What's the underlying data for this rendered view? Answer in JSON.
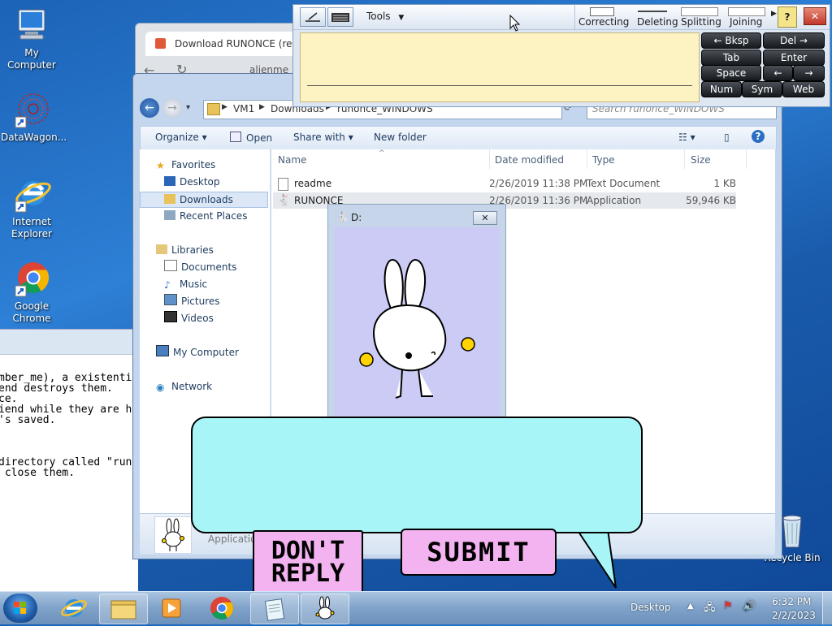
{
  "desktop": {
    "icons": [
      {
        "label": "My Computer"
      },
      {
        "label": "DataWagon..."
      },
      {
        "label": "Internet Explorer"
      },
      {
        "label": "Google Chrome"
      },
      {
        "label": "Recycle Bin"
      }
    ]
  },
  "notepad": {
    "lines": [
      "mber_me), a existenti",
      "end destroys them.",
      "ce.",
      "iend while they are h",
      "'s saved.",
      "",
      "",
      "directory called \"run",
      " close them."
    ]
  },
  "chrome_window": {
    "tab_title": "Download RUNONCE (reme",
    "address_partial": "alienme"
  },
  "explorer": {
    "breadcrumb": [
      "VM1",
      "Downloads",
      "runonce_WINDOWS"
    ],
    "search_placeholder": "Search runonce_WINDOWS",
    "toolbar": {
      "organize": "Organize",
      "open": "Open",
      "share_with": "Share with",
      "new_folder": "New folder"
    },
    "nav": {
      "favorites": "Favorites",
      "desktop": "Desktop",
      "downloads": "Downloads",
      "recent_places": "Recent Places",
      "libraries": "Libraries",
      "documents": "Documents",
      "music": "Music",
      "pictures": "Pictures",
      "videos": "Videos",
      "my_computer": "My Computer",
      "network": "Network"
    },
    "columns": {
      "name": "Name",
      "date": "Date modified",
      "type": "Type",
      "size": "Size"
    },
    "files": [
      {
        "name": "readme",
        "date": "2/26/2019 11:38 PM",
        "type": "Text Document",
        "size": "1 KB"
      },
      {
        "name": "RUNONCE",
        "date": "2/26/2019 11:36 PM",
        "type": "Application",
        "size": "59,946 KB"
      }
    ],
    "details_text": "Application"
  },
  "tip_panel": {
    "tools_label": "Tools",
    "gestures": {
      "correcting": "Correcting",
      "deleting": "Deleting",
      "splitting": "Splitting",
      "joining": "Joining"
    },
    "keys": {
      "bksp": "← Bksp",
      "del": "Del →",
      "tab": "Tab",
      "enter": "Enter",
      "space": "Space",
      "left": "←",
      "right": "→",
      "num": "Num",
      "sym": "Sym",
      "web": "Web"
    }
  },
  "popup": {
    "title": "D:"
  },
  "dialog": {
    "dont_reply": "DON'T REPLY",
    "submit": "SUBMIT"
  },
  "taskbar": {
    "desktop_label": "Desktop",
    "time": "6:32 PM",
    "date": "2/2/2023"
  }
}
